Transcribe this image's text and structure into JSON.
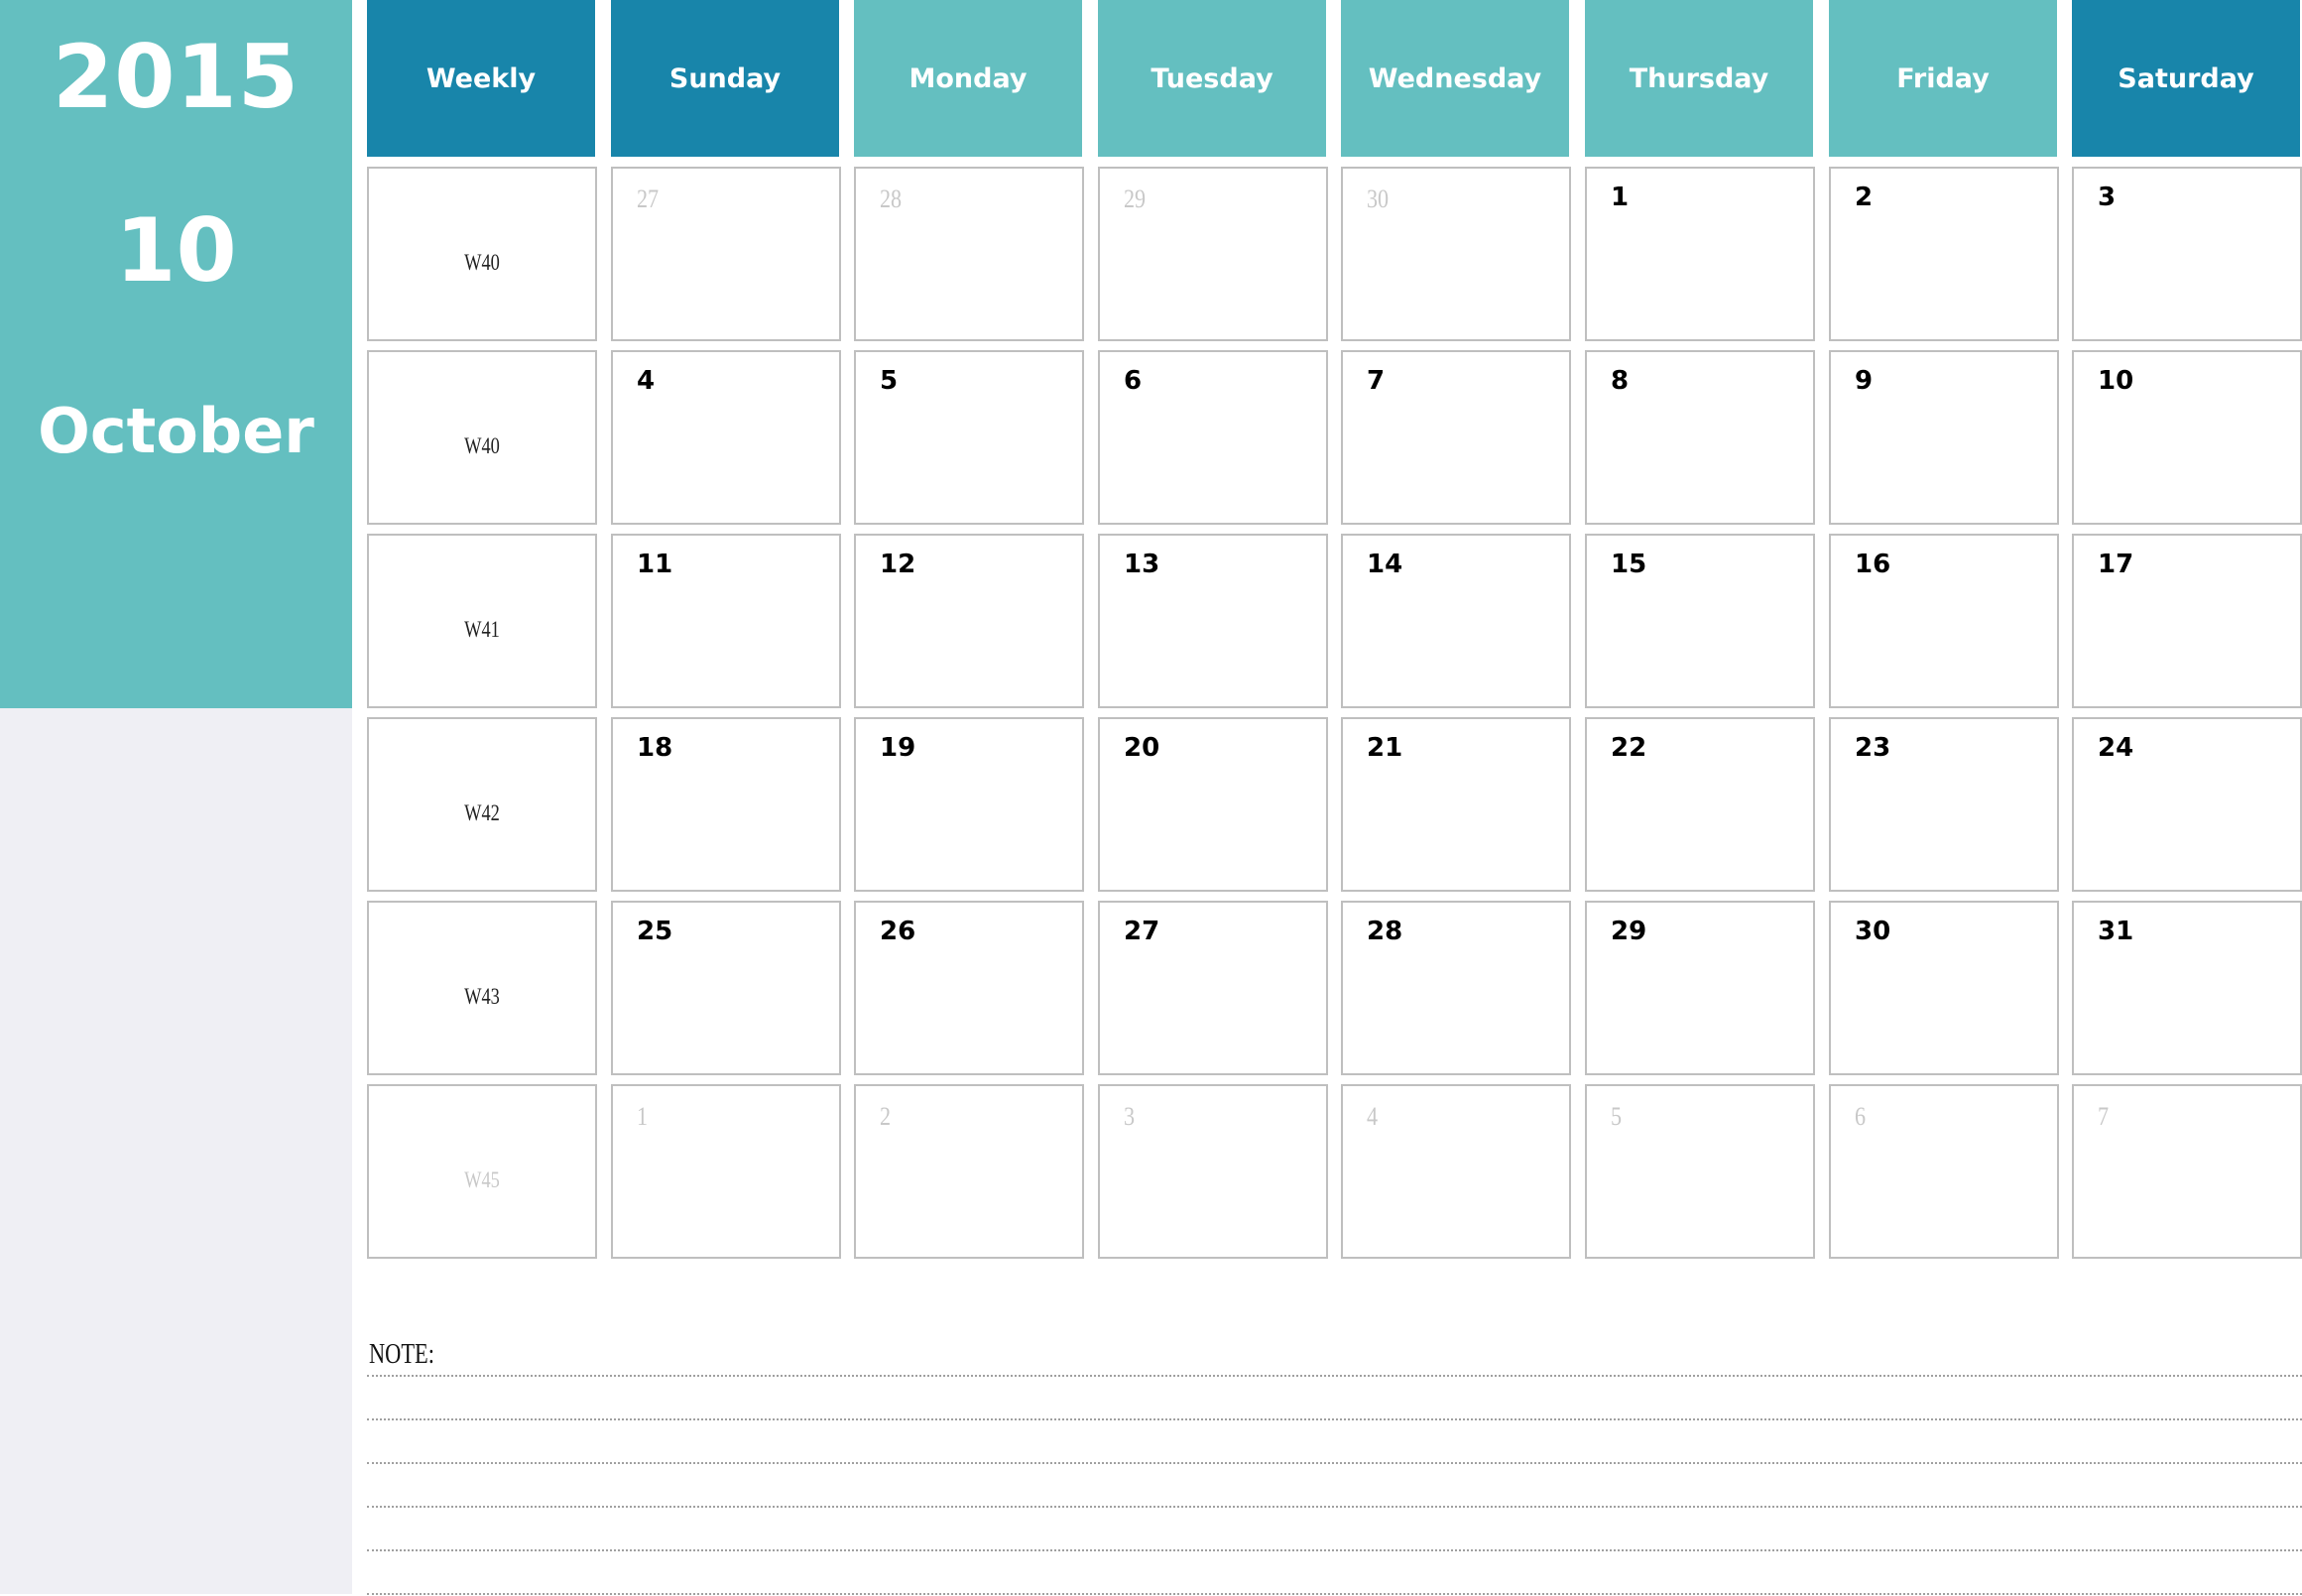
{
  "sidebar": {
    "year": "2015",
    "month_number": "10",
    "month_name": "October"
  },
  "colors": {
    "teal": "#64BFC0",
    "dark_blue": "#1885AA",
    "sidebar_lower": "#EFEFF4",
    "cell_border": "#BFBFBF",
    "faded_text": "#C8C8C8"
  },
  "header": [
    {
      "label": "Weekly",
      "style": "dark"
    },
    {
      "label": "Sunday",
      "style": "dark"
    },
    {
      "label": "Monday",
      "style": "light"
    },
    {
      "label": "Tuesday",
      "style": "light"
    },
    {
      "label": "Wednesday",
      "style": "light"
    },
    {
      "label": "Thursday",
      "style": "light"
    },
    {
      "label": "Friday",
      "style": "light"
    },
    {
      "label": "Saturday",
      "style": "dark"
    }
  ],
  "weeks": [
    {
      "week": "W40",
      "week_faded": false,
      "days": [
        {
          "n": "27",
          "faded": true
        },
        {
          "n": "28",
          "faded": true
        },
        {
          "n": "29",
          "faded": true
        },
        {
          "n": "30",
          "faded": true
        },
        {
          "n": "1",
          "faded": false
        },
        {
          "n": "2",
          "faded": false
        },
        {
          "n": "3",
          "faded": false
        }
      ]
    },
    {
      "week": "W40",
      "week_faded": false,
      "days": [
        {
          "n": "4",
          "faded": false
        },
        {
          "n": "5",
          "faded": false
        },
        {
          "n": "6",
          "faded": false
        },
        {
          "n": "7",
          "faded": false
        },
        {
          "n": "8",
          "faded": false
        },
        {
          "n": "9",
          "faded": false
        },
        {
          "n": "10",
          "faded": false
        }
      ]
    },
    {
      "week": "W41",
      "week_faded": false,
      "days": [
        {
          "n": "11",
          "faded": false
        },
        {
          "n": "12",
          "faded": false
        },
        {
          "n": "13",
          "faded": false
        },
        {
          "n": "14",
          "faded": false
        },
        {
          "n": "15",
          "faded": false
        },
        {
          "n": "16",
          "faded": false
        },
        {
          "n": "17",
          "faded": false
        }
      ]
    },
    {
      "week": "W42",
      "week_faded": false,
      "days": [
        {
          "n": "18",
          "faded": false
        },
        {
          "n": "19",
          "faded": false
        },
        {
          "n": "20",
          "faded": false
        },
        {
          "n": "21",
          "faded": false
        },
        {
          "n": "22",
          "faded": false
        },
        {
          "n": "23",
          "faded": false
        },
        {
          "n": "24",
          "faded": false
        }
      ]
    },
    {
      "week": "W43",
      "week_faded": false,
      "days": [
        {
          "n": "25",
          "faded": false
        },
        {
          "n": "26",
          "faded": false
        },
        {
          "n": "27",
          "faded": false
        },
        {
          "n": "28",
          "faded": false
        },
        {
          "n": "29",
          "faded": false
        },
        {
          "n": "30",
          "faded": false
        },
        {
          "n": "31",
          "faded": false
        }
      ]
    },
    {
      "week": "W45",
      "week_faded": true,
      "days": [
        {
          "n": "1",
          "faded": true
        },
        {
          "n": "2",
          "faded": true
        },
        {
          "n": "3",
          "faded": true
        },
        {
          "n": "4",
          "faded": true
        },
        {
          "n": "5",
          "faded": true
        },
        {
          "n": "6",
          "faded": true
        },
        {
          "n": "7",
          "faded": true
        }
      ]
    }
  ],
  "notes": {
    "label": "NOTE:",
    "line_count": 6
  }
}
